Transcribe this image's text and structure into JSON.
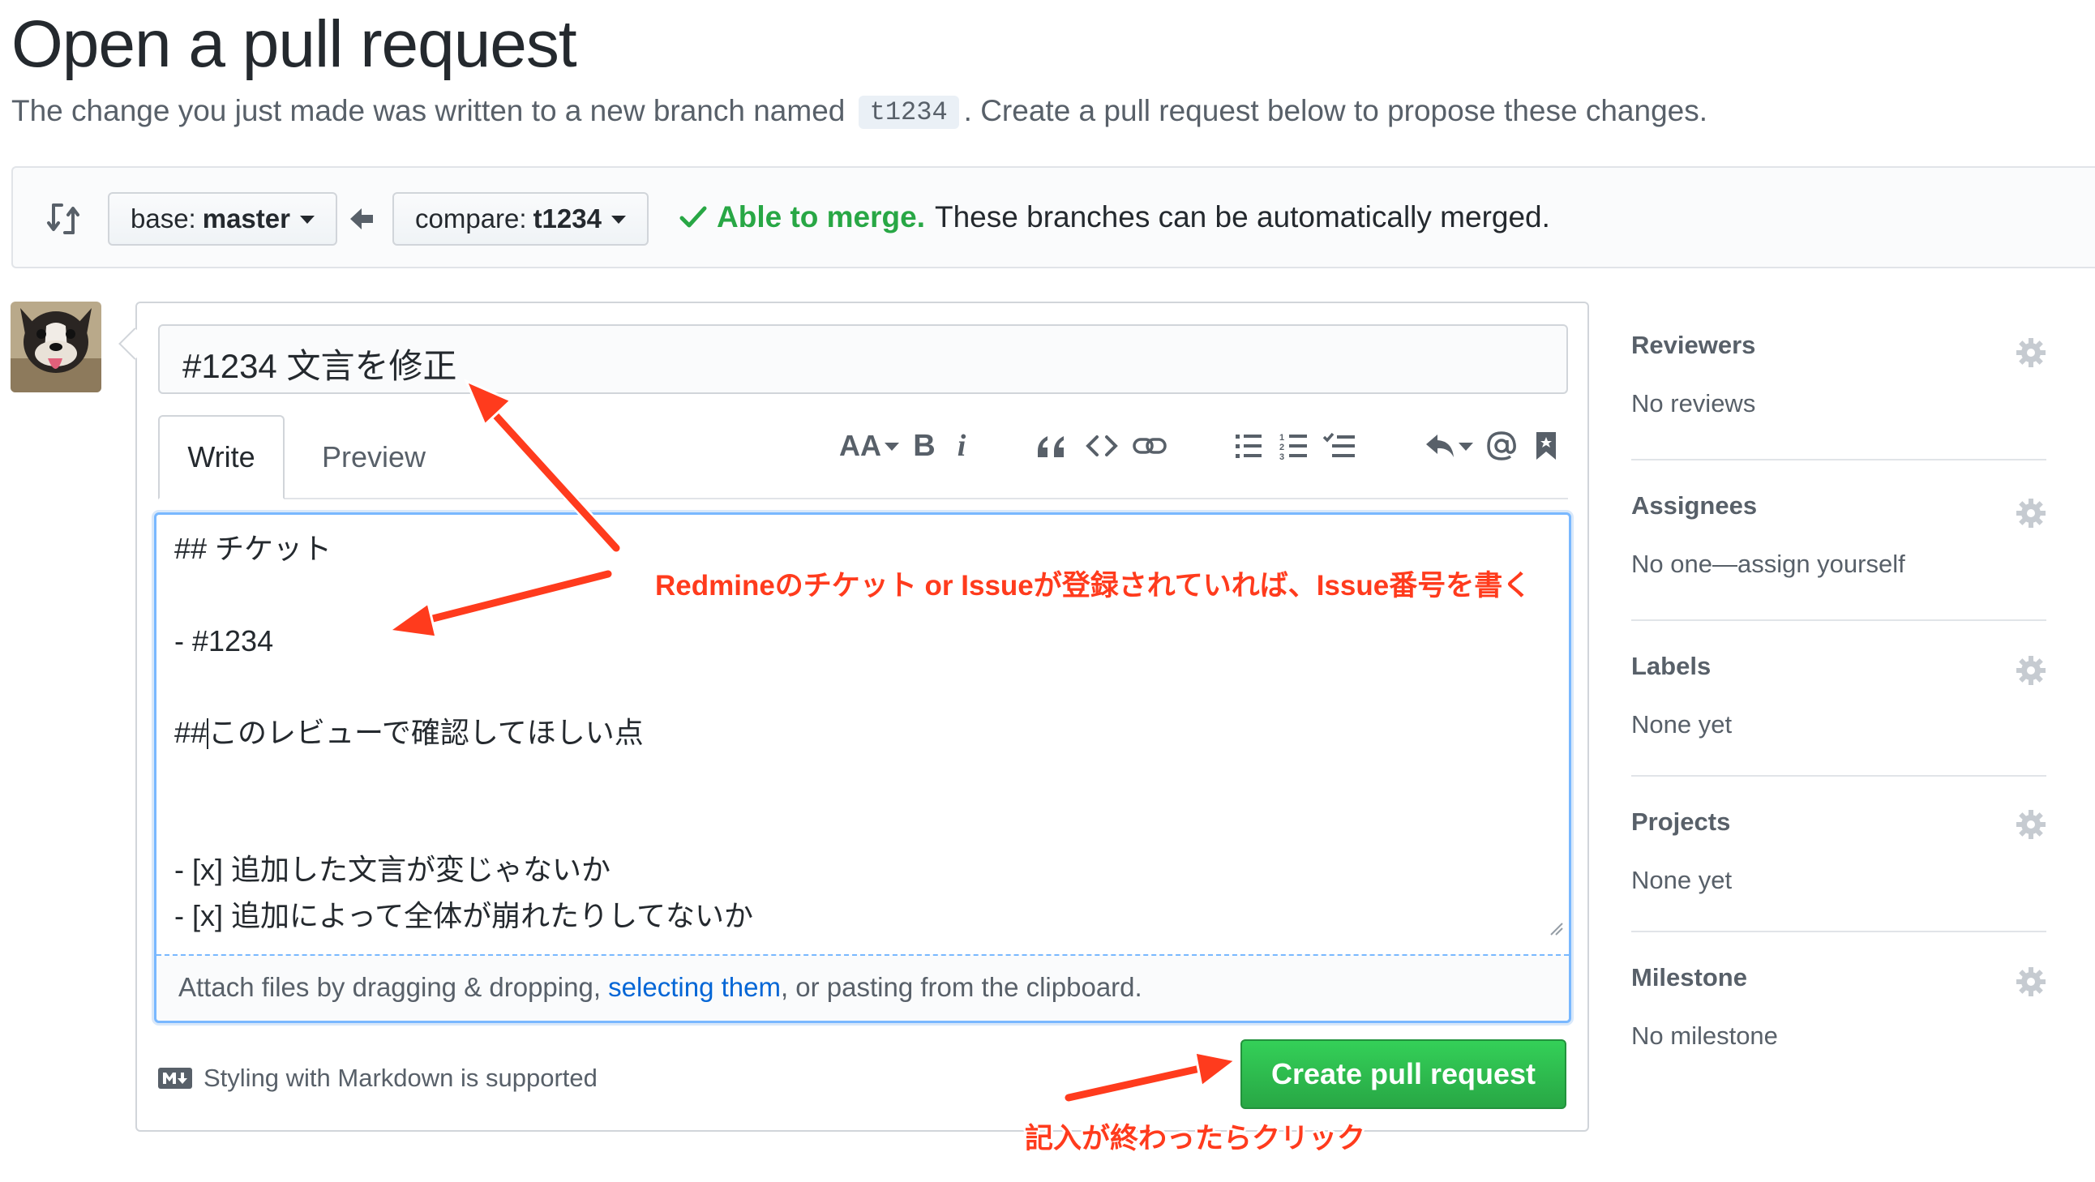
{
  "header": {
    "title": "Open a pull request",
    "subtitle_before": "The change you just made was written to a new branch named ",
    "branch_name": "t1234",
    "subtitle_after": ". Create a pull request below to propose these changes."
  },
  "compare_bar": {
    "base_prefix": "base:",
    "base_branch": "master",
    "compare_prefix": "compare:",
    "compare_branch": "t1234",
    "merge_ok": "Able to merge.",
    "merge_msg": "These branches can be automatically merged."
  },
  "form": {
    "title_value": "#1234 文言を修正",
    "tabs": {
      "write": "Write",
      "preview": "Preview"
    },
    "toolbar": {
      "heading": "AA",
      "bold": "B",
      "italic": "i"
    },
    "body_lines": [
      "## チケット",
      "",
      "- #1234",
      "",
      "##",
      "このレビューで確認してほしい点",
      "",
      "",
      "- [x] 追加した文言が変じゃないか",
      "- [x] 追加によって全体が崩れたりしてないか"
    ],
    "attach": {
      "before": "Attach files by dragging & dropping, ",
      "link": "selecting them",
      "after": ", or pasting from the clipboard."
    },
    "markdown_note": "Styling with Markdown is supported",
    "submit_label": "Create pull request"
  },
  "sidebar": {
    "sections": [
      {
        "title": "Reviewers",
        "value": "No reviews"
      },
      {
        "title": "Assignees",
        "value": "No one—assign yourself"
      },
      {
        "title": "Labels",
        "value": "None yet"
      },
      {
        "title": "Projects",
        "value": "None yet"
      },
      {
        "title": "Milestone",
        "value": "No milestone"
      }
    ]
  },
  "annotations": {
    "issue_note": "Redmineのチケット or Issueが登録されていれば、Issue番号を書く",
    "click_note": "記入が終わったらクリック",
    "color": "#ff3b1d"
  },
  "colors": {
    "accent_green": "#28a745",
    "link_blue": "#0366d6",
    "focus_border": "#79b8ff"
  }
}
